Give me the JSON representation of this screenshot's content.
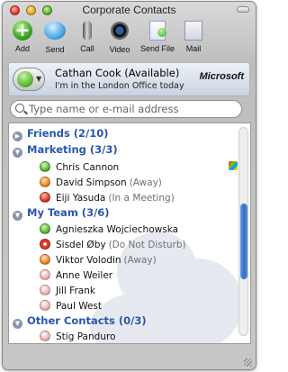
{
  "window": {
    "title": "Corporate Contacts"
  },
  "toolbar": [
    {
      "label": "Add",
      "icon": "add-contact-icon"
    },
    {
      "label": "Send",
      "icon": "send-message-icon"
    },
    {
      "label": "Call",
      "icon": "microphone-icon"
    },
    {
      "label": "Video",
      "icon": "webcam-icon"
    },
    {
      "label": "Send File",
      "icon": "send-file-icon"
    },
    {
      "label": "Mail",
      "icon": "mail-icon"
    }
  ],
  "profile": {
    "name": "Cathan Cook (Available)",
    "message": "I'm in the London Office today",
    "brand": "Microsoft"
  },
  "search": {
    "placeholder": "Type name or e-mail address"
  },
  "groups": [
    {
      "label": "Friends (2/10)"
    },
    {
      "label": "Marketing (3/3)"
    },
    {
      "label": "My Team (3/6)"
    },
    {
      "label": "Other Contacts (0/3)"
    }
  ],
  "contacts": [
    {
      "name": "Chris Cannon",
      "note": "",
      "status": "online"
    },
    {
      "name": "David Simpson",
      "note": "(Away)",
      "status": "away"
    },
    {
      "name": "Eiji Yasuda",
      "note": "(In a Meeting)",
      "status": "busy"
    },
    {
      "name": "Agnieszka Wojciechowska",
      "note": "",
      "status": "online"
    },
    {
      "name": "Sisdel Øby",
      "note": "(Do Not Disturb)",
      "status": "dnd"
    },
    {
      "name": "Viktor Volodin",
      "note": "(Away)",
      "status": "away"
    },
    {
      "name": "Anne Weiler",
      "note": "",
      "status": "offline"
    },
    {
      "name": "Jill Frank",
      "note": "",
      "status": "offline"
    },
    {
      "name": "Paul West",
      "note": "",
      "status": "offline"
    },
    {
      "name": "Stig Panduro",
      "note": "",
      "status": "offline"
    }
  ]
}
